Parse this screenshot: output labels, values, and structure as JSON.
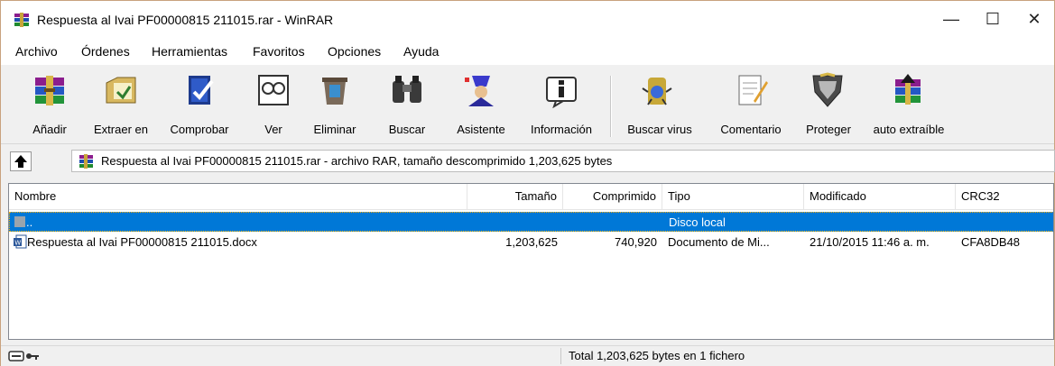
{
  "window": {
    "title": "Respuesta al Ivai PF00000815 211015.rar - WinRAR",
    "controls": {
      "minimize": "—",
      "maximize": "☐",
      "close": "✕"
    }
  },
  "menu": [
    "Archivo",
    "Órdenes",
    "Herramientas",
    "Favoritos",
    "Opciones",
    "Ayuda"
  ],
  "toolbar": [
    {
      "label": "Añadir",
      "icon": "add-archive-icon"
    },
    {
      "label": "Extraer en",
      "icon": "extract-icon"
    },
    {
      "label": "Comprobar",
      "icon": "test-icon"
    },
    {
      "label": "Ver",
      "icon": "view-icon"
    },
    {
      "label": "Eliminar",
      "icon": "delete-icon"
    },
    {
      "label": "Buscar",
      "icon": "find-binoculars-icon"
    },
    {
      "label": "Asistente",
      "icon": "wizard-icon"
    },
    {
      "label": "Información",
      "icon": "info-icon"
    },
    {
      "label": "Buscar virus",
      "icon": "virus-scan-icon"
    },
    {
      "label": "Comentario",
      "icon": "comment-icon"
    },
    {
      "label": "Proteger",
      "icon": "protect-shield-icon"
    },
    {
      "label": "auto extraíble",
      "icon": "sfx-icon"
    }
  ],
  "address": {
    "text": "Respuesta al Ivai PF00000815 211015.rar - archivo RAR, tamaño descomprimido 1,203,625 bytes"
  },
  "columns": [
    "Nombre",
    "Tamaño",
    "Comprimido",
    "Tipo",
    "Modificado",
    "CRC32"
  ],
  "files": [
    {
      "name": "..",
      "size": "",
      "packed": "",
      "type": "Disco local",
      "modified": "",
      "crc": "",
      "selected": true
    },
    {
      "name": "Respuesta al Ivai PF00000815 211015.docx",
      "size": "1,203,625",
      "packed": "740,920",
      "type": "Documento de Mi...",
      "modified": "21/10/2015 11:46 a. m.",
      "crc": "CFA8DB48",
      "selected": false
    }
  ],
  "status": {
    "total": "Total 1,203,625 bytes en 1 fichero"
  },
  "colors": {
    "selection": "#0078d7",
    "accent_winrar": "#7b2d8e"
  }
}
